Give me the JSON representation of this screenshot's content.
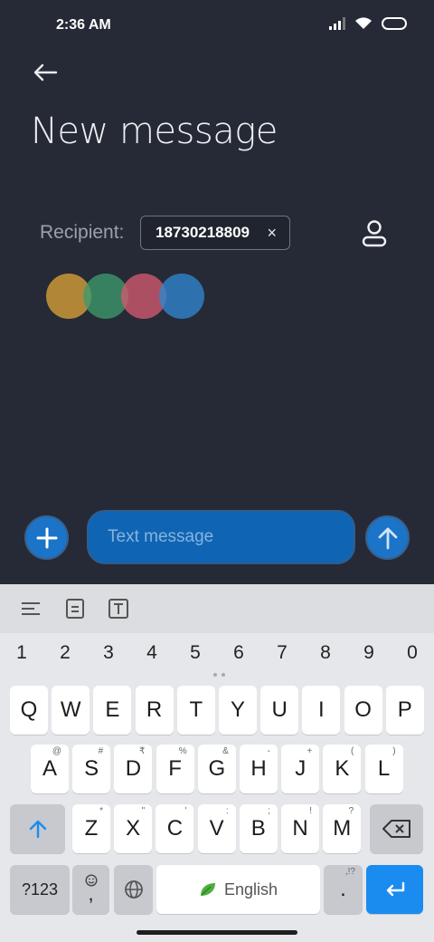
{
  "status_bar": {
    "time": "2:36 AM"
  },
  "header": {
    "title": "New message"
  },
  "recipient": {
    "label": "Recipient:",
    "chip_number": "18730218809",
    "chip_close": "×"
  },
  "colors": {
    "circle_1": "#d9a137",
    "circle_2": "#3e9a6b",
    "circle_3": "#d45a6e",
    "circle_4": "#2f86cf",
    "accent": "#1a8cf0"
  },
  "compose": {
    "placeholder": "Text message"
  },
  "keyboard": {
    "number_row": [
      "1",
      "2",
      "3",
      "4",
      "5",
      "6",
      "7",
      "8",
      "9",
      "0"
    ],
    "row1": [
      "Q",
      "W",
      "E",
      "R",
      "T",
      "Y",
      "U",
      "I",
      "O",
      "P"
    ],
    "row2": [
      "A",
      "S",
      "D",
      "F",
      "G",
      "H",
      "J",
      "K",
      "L"
    ],
    "row2_hints": [
      "@",
      "#",
      "₹",
      "%",
      "&",
      "-",
      "+",
      "(",
      ")"
    ],
    "row3": [
      "Z",
      "X",
      "C",
      "V",
      "B",
      "N",
      "M"
    ],
    "row3_hints": [
      "*",
      "\"",
      "'",
      ":",
      ";",
      "!",
      "?"
    ],
    "sym_key": "?123",
    "comma_key": ",",
    "space_label": "English",
    "period_key": ".",
    "period_hint": ",!?"
  }
}
